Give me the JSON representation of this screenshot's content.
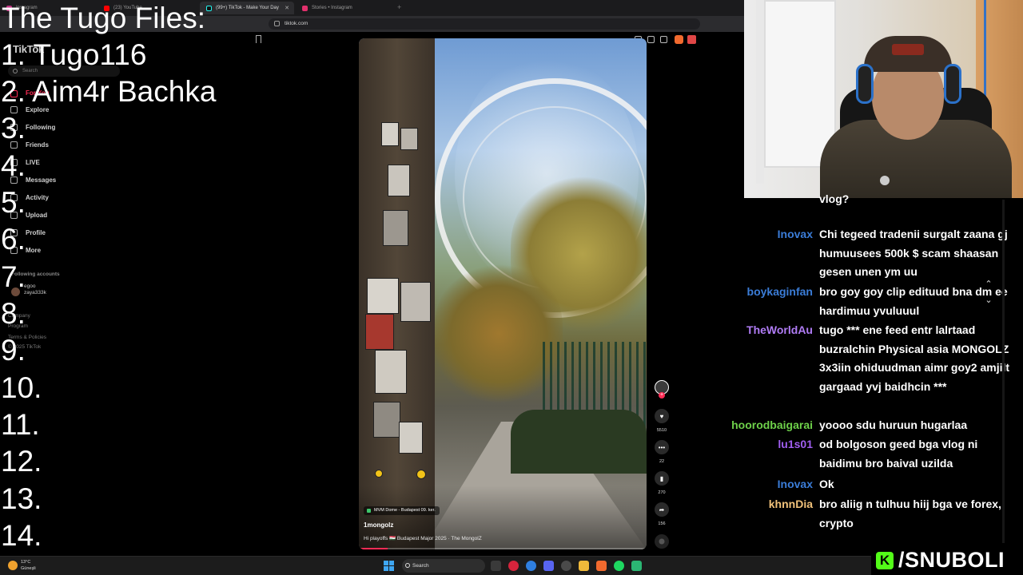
{
  "browser": {
    "tabs": [
      {
        "label": "Instagram"
      },
      {
        "label": "(23) YouTube"
      },
      {
        "label": "(99+) TikTok - Make Your Day"
      },
      {
        "label": "Stories • Instagram"
      }
    ],
    "url": "tiktok.com"
  },
  "tiktok": {
    "logo": "TikTok",
    "search_placeholder": "Search",
    "nav": [
      {
        "label": "For You"
      },
      {
        "label": "Explore"
      },
      {
        "label": "Following"
      },
      {
        "label": "Friends"
      },
      {
        "label": "LIVE"
      },
      {
        "label": "Messages"
      },
      {
        "label": "Activity"
      },
      {
        "label": "Upload"
      },
      {
        "label": "Profile"
      },
      {
        "label": "More"
      }
    ],
    "following_heading": "Following accounts",
    "following_account": {
      "name": "egoo",
      "handle": "zaya333k"
    },
    "footer": [
      {
        "label": "Company"
      },
      {
        "label": "Program"
      },
      {
        "label": "Terms & Policies"
      },
      {
        "label": "© 2025 TikTok"
      }
    ]
  },
  "overlay": {
    "title": "The Tugo Files:",
    "items": [
      "1. Tugo116",
      "2. Aim4r Bachka",
      "3.",
      "4.",
      "5.",
      "6.",
      "7.",
      "8.",
      "9.",
      "10.",
      "11.",
      "12.",
      "13.",
      "14."
    ]
  },
  "video": {
    "location": "MVM Dome - Budapest 09. ker.",
    "username": "1mongolz",
    "caption": "Hi playoffs 🇭🇺 Budapest Major 2025 · The MongolZ",
    "progress": 0.1
  },
  "actions": {
    "likes": "5510",
    "comments": "22",
    "saves": "270",
    "shares": "156"
  },
  "chat": {
    "messages": [
      {
        "user": "",
        "message": "vlog?",
        "color": "#ffffff"
      },
      {
        "user": "Inovax",
        "message": "Chi tegeed tradenii surgalt zaana gj humuusees 500k $ scam shaasan gesen unen ym uu",
        "color": "#3b7dd8"
      },
      {
        "user": "boykaginfan",
        "message": "bro goy goy clip edituud bna dm ee hardimuu yvuluuul",
        "color": "#3b7dd8"
      },
      {
        "user": "TheWorldAu",
        "message": "tugo *** ene feed entr lalrtaad buzralchin Physical asia MONGOLZ 3x3iin ohiduudman aimr goy2 amjilt gargaad yvj baidhcin ***",
        "color": "#b07cf5"
      },
      {
        "user": "hoorodbaigarai",
        "message": "yoooo sdu huruun hugarlaa",
        "color": "#6ed14a"
      },
      {
        "user": "lu1s01",
        "message": "od bolgoson geed bga vlog ni baidimu bro baival uzilda",
        "color": "#a05ef0"
      },
      {
        "user": "Inovax",
        "message": "Ok",
        "color": "#3b7dd8"
      },
      {
        "user": "khnnDia",
        "message": "bro aliig n tulhuu hiij bga ve forex, crypto",
        "color": "#f1c27a"
      }
    ]
  },
  "taskbar": {
    "weather_temp": "13°C",
    "weather_desc": "Güneşli",
    "search": "Search"
  },
  "brand": {
    "badge": "K",
    "text": "/SNUBOLI",
    "color": "#53fc18"
  }
}
